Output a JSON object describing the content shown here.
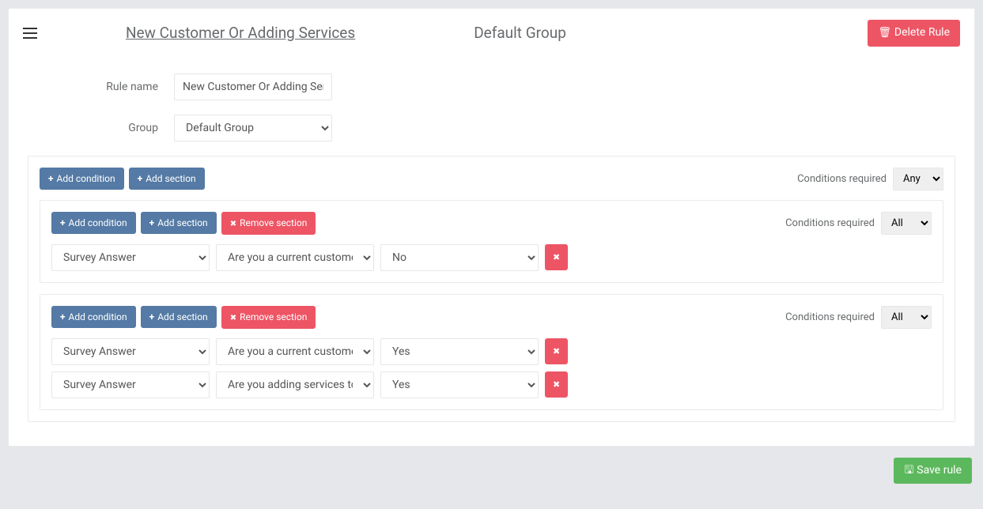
{
  "header": {
    "rule_title": "New Customer Or Adding Services",
    "group_title": "Default Group",
    "delete_label": "Delete Rule"
  },
  "form": {
    "rule_name_label": "Rule name",
    "rule_name_value": "New Customer Or Adding Services",
    "group_label": "Group",
    "group_value": "Default Group"
  },
  "labels": {
    "add_condition": "Add condition",
    "add_section": "Add section",
    "remove_section": "Remove section",
    "conditions_required": "Conditions required",
    "save_rule": "Save rule"
  },
  "outer_section": {
    "conditions_required": "Any"
  },
  "sections": [
    {
      "conditions_required": "All",
      "conditions": [
        {
          "type": "Survey Answer",
          "question": "Are you a current customer?",
          "answer": "No"
        }
      ]
    },
    {
      "conditions_required": "All",
      "conditions": [
        {
          "type": "Survey Answer",
          "question": "Are you a current customer?",
          "answer": "Yes"
        },
        {
          "type": "Survey Answer",
          "question": "Are you adding services to your existing account?",
          "answer": "Yes"
        }
      ]
    }
  ],
  "select_options": {
    "cond_required": [
      "Any",
      "All"
    ],
    "type": [
      "Survey Answer"
    ],
    "answer": [
      "Yes",
      "No"
    ]
  }
}
